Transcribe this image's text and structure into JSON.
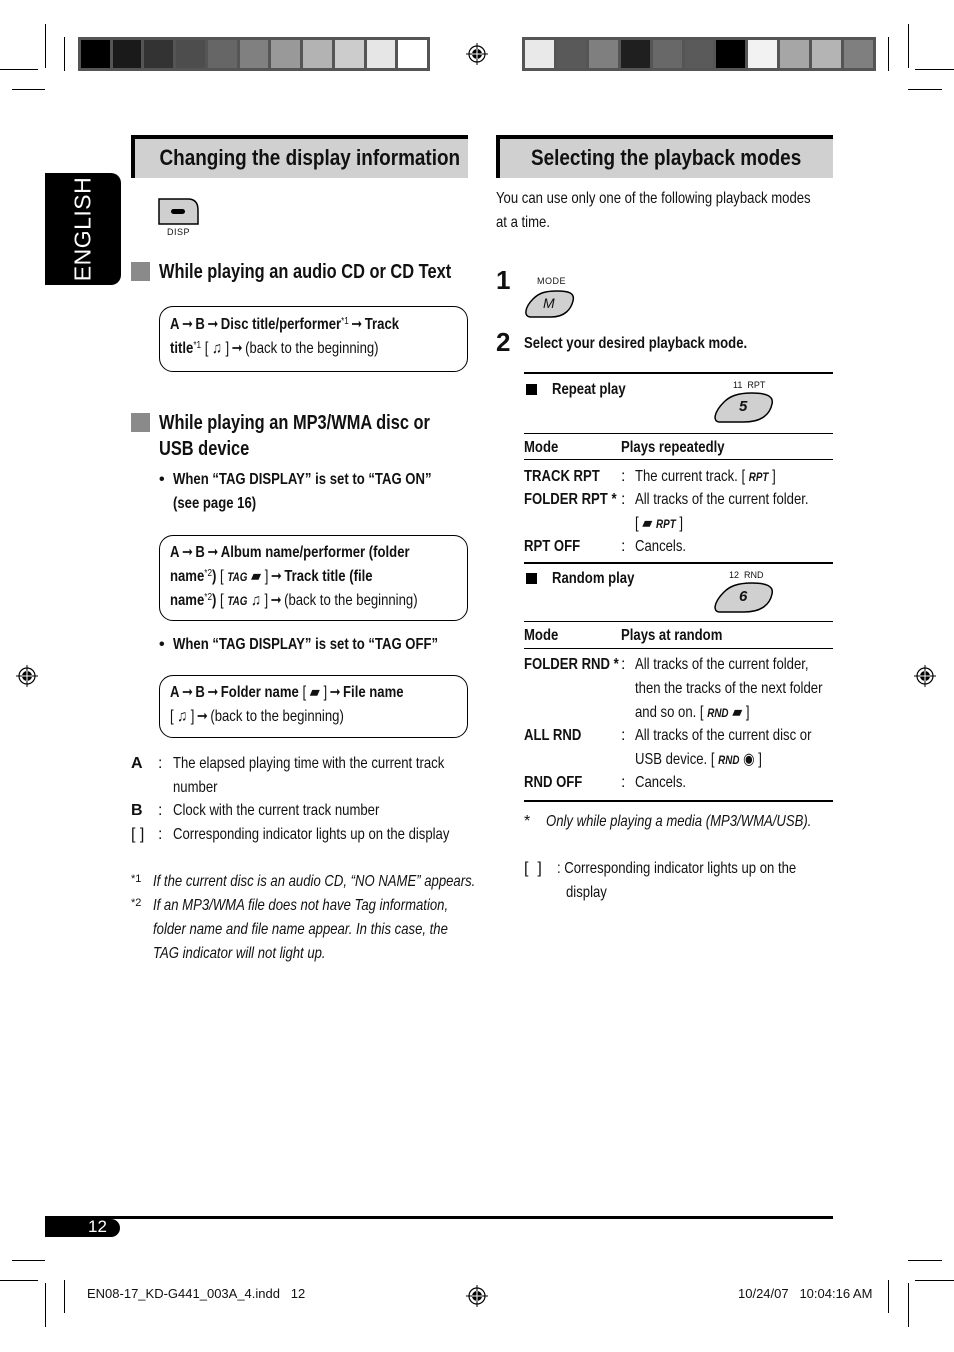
{
  "print_marks": {
    "left_colorbar": [
      "#000000",
      "#1a1a1a",
      "#333333",
      "#4d4d4d",
      "#666666",
      "#808080",
      "#999999",
      "#b3b3b3",
      "#cccccc",
      "#e6e6e6",
      "#ffffff"
    ],
    "right_colorbar": [
      "#e9e9e9",
      "#595959",
      "#7f7f7f",
      "#1f1f1f",
      "#686868",
      "#5a5a5a",
      "#000000",
      "#f2f2f2",
      "#a6a6a6",
      "#b4b4b4",
      "#7f7f7f"
    ]
  },
  "language_tab": "ENGLISH",
  "left": {
    "title": "Changing the display information",
    "disp_button_label": "DISP",
    "cd_heading": "While playing an audio CD or CD Text",
    "cd_flow": {
      "a": "A",
      "b": "B",
      "disc_title": "Disc title/performer",
      "note1": "*1",
      "track": "Track",
      "title": "title",
      "note1b": "*1",
      "back": "(back to the beginning)"
    },
    "mp3_heading_line1": "While playing an MP3/WMA disc or",
    "mp3_heading_line2": "USB device",
    "tag_on_bullet_line1": "When “TAG DISPLAY” is set to “TAG ON”",
    "tag_on_bullet_line2": "(see page 16)",
    "tag_on_flow": {
      "album": "Album name/performer (folder",
      "name1": "name",
      "note2": "*2",
      "tag": "TAG",
      "track_title": "Track title (file",
      "name2": "name",
      "note2b": "*2",
      "back": "(back to the beginning)"
    },
    "tag_off_bullet": "When “TAG DISPLAY” is set to “TAG OFF”",
    "tag_off_flow": {
      "folder_name": "Folder name",
      "file_name": "File name",
      "back": "(back to the beginning)"
    },
    "legend": [
      {
        "key": "A",
        "text": "The elapsed playing time with the current track",
        "text2": "number"
      },
      {
        "key": "B",
        "text": "Clock with the current track number"
      },
      {
        "key": "[ ]",
        "text": "Corresponding indicator lights up on the display"
      }
    ],
    "footnotes": [
      {
        "mark": "*1",
        "text": "If the current disc is an audio CD, “NO NAME” appears."
      },
      {
        "mark": "*2",
        "lines": [
          "If an MP3/WMA file does not have Tag information,",
          "folder name and file name appear. In this case, the",
          "TAG indicator will not light up."
        ]
      }
    ]
  },
  "right": {
    "title": "Selecting the playback modes",
    "intro_line1": "You can use only one of the following playback modes",
    "intro_line2": "at a time.",
    "step1_num": "1",
    "mode_button_label": "MODE",
    "mode_button_key": "M",
    "step2_num": "2",
    "step2_text": "Select your desired playback mode.",
    "repeat": {
      "heading": "Repeat play",
      "button_top": "11  RPT",
      "button_key": "5",
      "col_mode": "Mode",
      "col_desc": "Plays repeatedly",
      "rows": [
        {
          "mode": "TRACK RPT",
          "desc": "The current track. [",
          "ind": "RPT",
          "close": "]"
        },
        {
          "mode": "FOLDER RPT *",
          "desc": "All tracks of the current folder.",
          "desc2_ind": "RPT"
        },
        {
          "mode": "RPT OFF",
          "desc": "Cancels."
        }
      ]
    },
    "random": {
      "heading": "Random play",
      "button_top": "12  RND",
      "button_key": "6",
      "col_mode": "Mode",
      "col_desc": "Plays at random",
      "rows": [
        {
          "mode": "FOLDER RND *",
          "lines": [
            "All tracks of the current folder,",
            "then the tracks of the next folder",
            "and so on. ["
          ],
          "ind": "RND"
        },
        {
          "mode": "ALL RND",
          "lines": [
            "All tracks of the current disc or",
            "USB device. ["
          ],
          "ind": "RND"
        },
        {
          "mode": "RND OFF",
          "lines": [
            "Cancels."
          ]
        }
      ]
    },
    "footnote_mark": "*",
    "footnote": "Only while playing a media (MP3/WMA/USB).",
    "bracket_key": "[  ]",
    "bracket_text_line1": ": Corresponding indicator lights up on the",
    "bracket_text_line2": "display"
  },
  "footer": {
    "page_number": "12",
    "file_info": "EN08-17_KD-G441_003A_4.indd   12",
    "timestamp": "10/24/07   10:04:16 AM"
  }
}
